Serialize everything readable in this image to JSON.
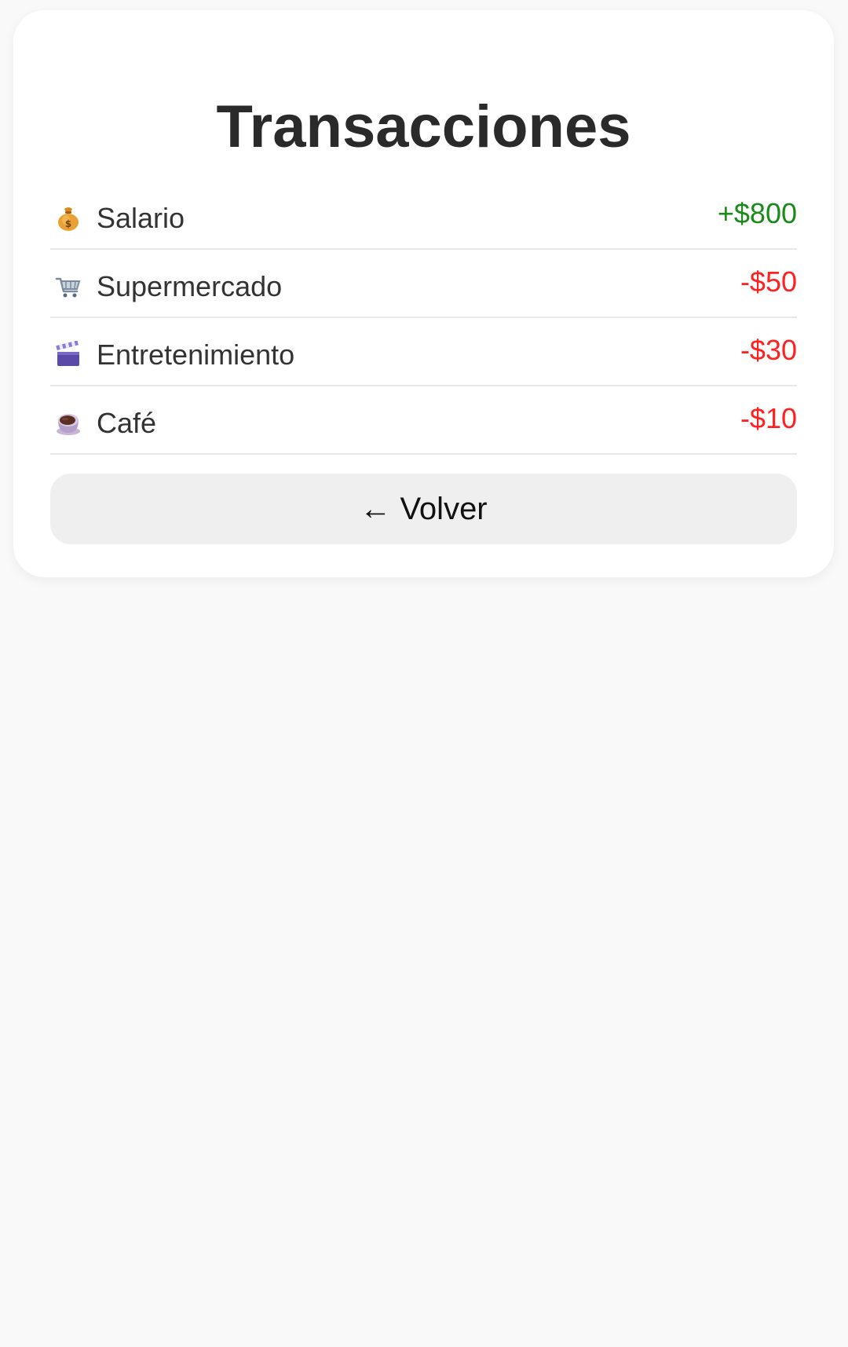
{
  "page": {
    "title": "Transacciones"
  },
  "colors": {
    "background": "#f9f9f9",
    "card": "#ffffff",
    "income": "#1a8a1a",
    "expense": "#ff2020",
    "button_bg": "#efefef"
  },
  "transactions": [
    {
      "icon": "money-bag-icon",
      "name": "Salario",
      "amount": "+$800",
      "type": "income"
    },
    {
      "icon": "shopping-cart-icon",
      "name": "Supermercado",
      "amount": "-$50",
      "type": "expense"
    },
    {
      "icon": "clapperboard-icon",
      "name": "Entretenimiento",
      "amount": "-$30",
      "type": "expense"
    },
    {
      "icon": "coffee-icon",
      "name": "Café",
      "amount": "-$10",
      "type": "expense"
    }
  ],
  "back_button": {
    "label": "← Volver"
  }
}
